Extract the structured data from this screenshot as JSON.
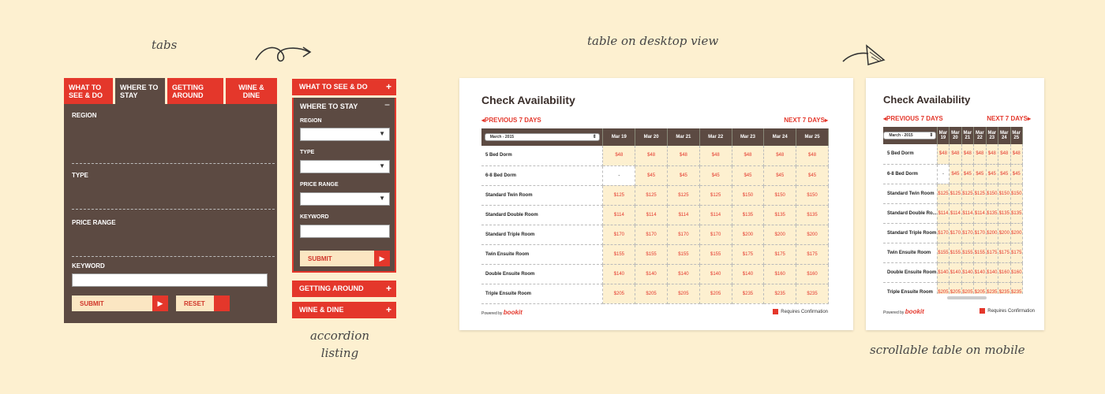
{
  "notes": {
    "tabs": "tabs",
    "accordion": "accordion listing",
    "desktop": "table on desktop view",
    "mobile": "scrollable table on mobile"
  },
  "tabs_widget": {
    "tabs": [
      "What to see & do",
      "Where to stay",
      "Getting around",
      "Wine & dine"
    ],
    "active_tab": 1,
    "fields": [
      "Region",
      "Type",
      "Price range",
      "Keyword"
    ],
    "submit": "Submit",
    "reset": "Reset"
  },
  "accordion": {
    "items": [
      "What to see & do",
      "Where to stay",
      "Getting around",
      "Wine & dine"
    ],
    "open_item": 1,
    "fields": [
      "Region",
      "Type",
      "Price range",
      "Keyword"
    ],
    "submit": "Submit",
    "plus": "+",
    "minus": "−"
  },
  "availability": {
    "title": "Check Availability",
    "prev": "Previous 7 days",
    "next": "Next 7 days",
    "month": "March - 2015",
    "dates": [
      "Mar 19",
      "Mar 20",
      "Mar 21",
      "Mar 22",
      "Mar 23",
      "Mar 24",
      "Mar 25"
    ],
    "rows": [
      {
        "name": "5 Bed Dorm",
        "prices": [
          "$48",
          "$48",
          "$48",
          "$48",
          "$48",
          "$48",
          "$48"
        ]
      },
      {
        "name": "6-8 Bed Dorm",
        "prices": [
          "-",
          "$45",
          "$45",
          "$45",
          "$45",
          "$45",
          "$45"
        ]
      },
      {
        "name": "Standard Twin Room",
        "prices": [
          "$125",
          "$125",
          "$125",
          "$125",
          "$150",
          "$150",
          "$150"
        ]
      },
      {
        "name": "Standard Double Room",
        "prices": [
          "$114",
          "$114",
          "$114",
          "$114",
          "$135",
          "$135",
          "$135"
        ]
      },
      {
        "name": "Standard Triple Room",
        "prices": [
          "$170",
          "$170",
          "$170",
          "$170",
          "$200",
          "$200",
          "$200"
        ]
      },
      {
        "name": "Twin Ensuite Room",
        "prices": [
          "$155",
          "$155",
          "$155",
          "$155",
          "$175",
          "$175",
          "$175"
        ]
      },
      {
        "name": "Double Ensuite Room",
        "prices": [
          "$140",
          "$140",
          "$140",
          "$140",
          "$140",
          "$160",
          "$160"
        ]
      },
      {
        "name": "Triple Ensuite Room",
        "prices": [
          "$205",
          "$205",
          "$205",
          "$205",
          "$235",
          "$235",
          "$235"
        ]
      }
    ],
    "mobile_row_names": [
      "5 Bed Dorm",
      "6-8 Bed Dorm",
      "Standard Twin Room",
      "Standard Double Ro...",
      "Standard Triple Room",
      "Twin Ensuite Room",
      "Double Ensuite Room",
      "Triple Ensuite Room"
    ],
    "mobile_last_date": "Mar 2",
    "powered": "Powered by",
    "logo": "bookit",
    "requires": "Requires Confirmation"
  },
  "colors": {
    "red": "#e4372b",
    "brown": "#5c4a42",
    "cream": "#fdf0d0"
  }
}
